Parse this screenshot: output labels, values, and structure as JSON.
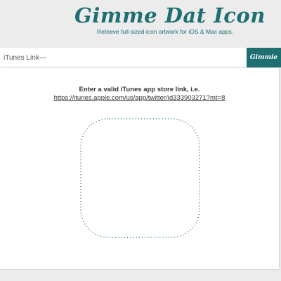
{
  "header": {
    "logo_text": "Gimme Dat Icon",
    "tagline": "Retrieve full-sized icon artwork for iOS & Mac apps."
  },
  "search": {
    "placeholder": "iTunes Link---",
    "value": "",
    "button_label": "Gimmie"
  },
  "main": {
    "instruction": "Enter a valid iTunes app store link, i.e.",
    "example_link": "https://itunes.apple.com/us/app/twitter/id333903271?mt=8",
    "icon_placeholder": "rounded-square-dotted-icon"
  },
  "colors": {
    "accent": "#1f6f72",
    "background": "#ececec",
    "card": "#ffffff",
    "text": "#333333"
  }
}
